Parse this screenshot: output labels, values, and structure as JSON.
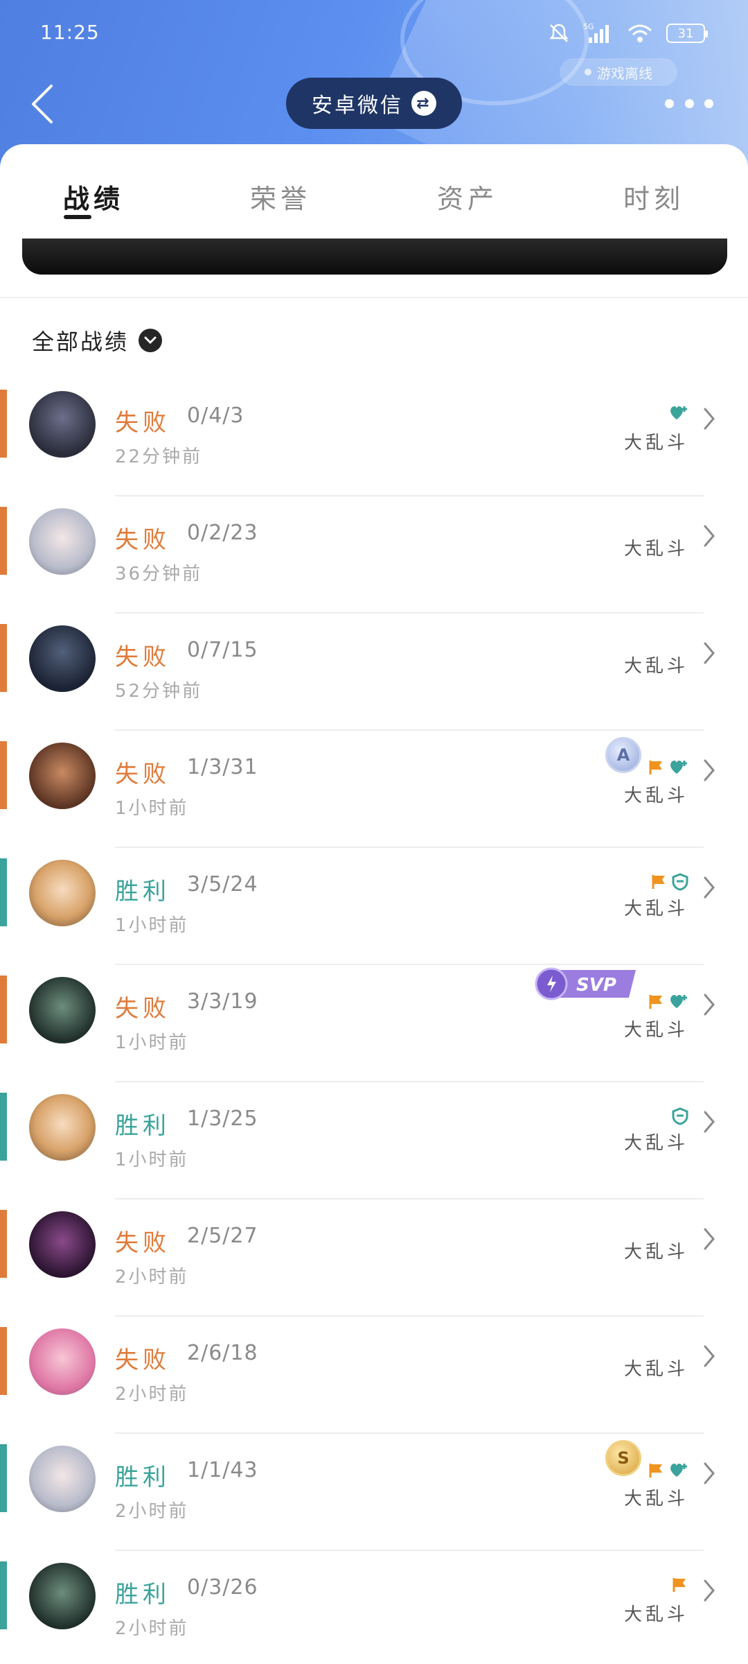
{
  "status_bar": {
    "time": "11:25",
    "battery": "31",
    "offline_label": "游戏离线"
  },
  "header": {
    "account_label": "安卓微信"
  },
  "tabs": [
    {
      "label": "战绩",
      "active": true
    },
    {
      "label": "荣誉",
      "active": false
    },
    {
      "label": "资产",
      "active": false
    },
    {
      "label": "时刻",
      "active": false
    }
  ],
  "filter": {
    "label": "全部战绩"
  },
  "colors": {
    "loss": "#e07b3a",
    "win": "#3aa39b",
    "loss_bar": "#e07b3a",
    "win_bar": "#3aa39b"
  },
  "matches": [
    {
      "result": "失败",
      "kda": "0/4/3",
      "time": "22分钟前",
      "mode": "大乱斗",
      "outcome": "loss",
      "icons": [
        "heart-plus-icon"
      ]
    },
    {
      "result": "失败",
      "kda": "0/2/23",
      "time": "36分钟前",
      "mode": "大乱斗",
      "outcome": "loss",
      "icons": []
    },
    {
      "result": "失败",
      "kda": "0/7/15",
      "time": "52分钟前",
      "mode": "大乱斗",
      "outcome": "loss",
      "icons": []
    },
    {
      "result": "失败",
      "kda": "1/3/31",
      "time": "1小时前",
      "mode": "大乱斗",
      "outcome": "loss",
      "icons": [
        "a-rating-badge",
        "flag-icon",
        "heart-plus-icon"
      ]
    },
    {
      "result": "胜利",
      "kda": "3/5/24",
      "time": "1小时前",
      "mode": "大乱斗",
      "outcome": "win",
      "icons": [
        "flag-icon",
        "shield-icon"
      ]
    },
    {
      "result": "失败",
      "kda": "3/3/19",
      "time": "1小时前",
      "mode": "大乱斗",
      "outcome": "loss",
      "icons": [
        "svp-badge",
        "flag-icon",
        "heart-plus-icon"
      ],
      "svp_label": "SVP"
    },
    {
      "result": "胜利",
      "kda": "1/3/25",
      "time": "1小时前",
      "mode": "大乱斗",
      "outcome": "win",
      "icons": [
        "shield-icon"
      ]
    },
    {
      "result": "失败",
      "kda": "2/5/27",
      "time": "2小时前",
      "mode": "大乱斗",
      "outcome": "loss",
      "icons": []
    },
    {
      "result": "失败",
      "kda": "2/6/18",
      "time": "2小时前",
      "mode": "大乱斗",
      "outcome": "loss",
      "icons": []
    },
    {
      "result": "胜利",
      "kda": "1/1/43",
      "time": "2小时前",
      "mode": "大乱斗",
      "outcome": "win",
      "icons": [
        "s-rating-badge",
        "flag-icon",
        "heart-plus-icon"
      ]
    },
    {
      "result": "胜利",
      "kda": "0/3/26",
      "time": "2小时前",
      "mode": "大乱斗",
      "outcome": "win",
      "icons": [
        "flag-icon"
      ]
    }
  ]
}
